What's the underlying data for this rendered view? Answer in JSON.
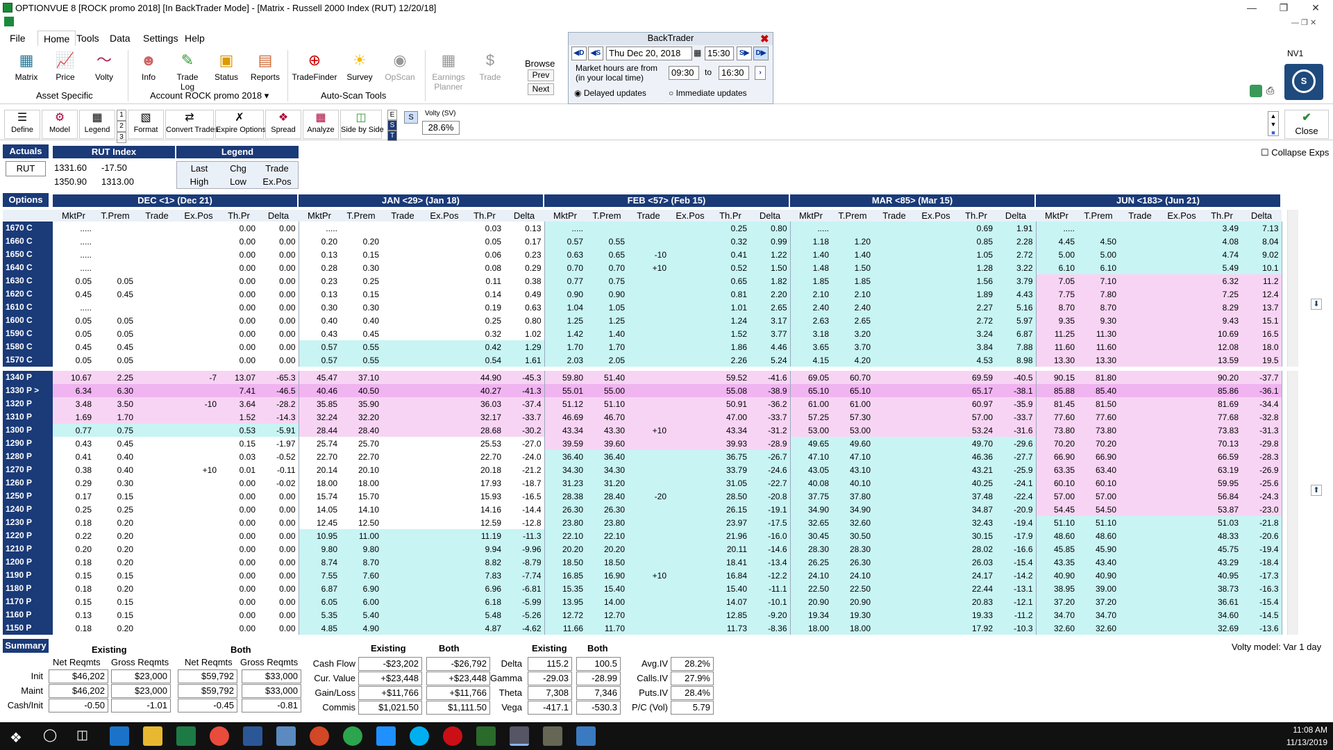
{
  "window": {
    "title": "OPTIONVUE 8   [ROCK promo 2018]   [In BackTrader Mode] - [Matrix - Russell 2000 Index (RUT)  12/20/18]"
  },
  "menu": [
    "File",
    "Home",
    "Tools",
    "Data",
    "Settings",
    "Help"
  ],
  "ribbon": {
    "asset_specific": {
      "label": "Asset Specific",
      "buttons": [
        "Matrix",
        "Price",
        "Volty"
      ]
    },
    "account": {
      "label": "Account ROCK promo 2018 ▾",
      "buttons": [
        "Info",
        "Trade Log",
        "Status",
        "Reports"
      ]
    },
    "autoscan": {
      "label": "Auto-Scan Tools",
      "buttons": [
        "TradeFinder",
        "Survey",
        "OpScan"
      ]
    },
    "extra": [
      "Earnings Planner",
      "Trade"
    ],
    "browse": {
      "label": "Browse",
      "prev": "Prev",
      "next": "Next"
    }
  },
  "backtrader": {
    "title": "BackTrader",
    "date": "Thu Dec 20, 2018",
    "time": "15:30",
    "market_hours_label": "Market hours are from (in your local time)",
    "from": "09:30",
    "to_label": "to",
    "to": "16:30",
    "delayed": "Delayed updates",
    "immediate": "Immediate updates",
    "btn_d": "D",
    "btn_s": "S",
    "btn_s2": "S",
    "btn_d2": "D"
  },
  "nv": "NV1",
  "toolbar2": {
    "buttons": [
      "Define",
      "Model",
      "Legend",
      "Format",
      "Convert Trades",
      "Expire Options",
      "Spread",
      "Analyze",
      "Side by Side"
    ],
    "nums": [
      "1",
      "2",
      "3"
    ],
    "est": [
      "E",
      "S",
      "T"
    ],
    "s_btn": "S",
    "volty_label": "Volty (SV)",
    "volty_value": "28.6%",
    "close": "Close"
  },
  "actuals": {
    "label": "Actuals",
    "symbol": "RUT",
    "index_title": "RUT Index",
    "last": "1331.60",
    "chg": "-17.50",
    "high": "1350.90",
    "low": "1313.00",
    "legend_title": "Legend",
    "legend": [
      "Last",
      "Chg",
      "Trade",
      "High",
      "Low",
      "Ex.Pos"
    ]
  },
  "collapse_label": "Collapse Exps",
  "options_label": "Options",
  "expirations": [
    "DEC <1> (Dec 21)",
    "JAN <29> (Jan 18)",
    "FEB <57> (Feb 15)",
    "MAR <85> (Mar 15)",
    "JUN <183> (Jun 21)"
  ],
  "columns": [
    "MktPr",
    "T.Prem",
    "Trade",
    "Ex.Pos",
    "Th.Pr",
    "Delta"
  ],
  "calls": [
    {
      "s": "1670 C",
      "r": [
        ".....",
        "",
        "",
        "",
        "0.00",
        "0.00",
        ".....",
        "",
        "",
        "",
        "0.03",
        "0.13",
        ".....",
        "",
        "",
        "",
        "0.25",
        "0.80",
        ".....",
        "",
        "",
        "",
        "0.69",
        "1.91",
        ".....",
        "",
        "",
        "",
        "3.49",
        "7.13"
      ]
    },
    {
      "s": "1660 C",
      "r": [
        ".....",
        "",
        "",
        "",
        "0.00",
        "0.00",
        "0.20",
        "0.20",
        "",
        "",
        "0.05",
        "0.17",
        "0.57",
        "0.55",
        "",
        "",
        "0.32",
        "0.99",
        "1.18",
        "1.20",
        "",
        "",
        "0.85",
        "2.28",
        "4.45",
        "4.50",
        "",
        "",
        "4.08",
        "8.04"
      ]
    },
    {
      "s": "1650 C",
      "r": [
        ".....",
        "",
        "",
        "",
        "0.00",
        "0.00",
        "0.13",
        "0.15",
        "",
        "",
        "0.06",
        "0.23",
        "0.63",
        "0.65",
        "-10",
        "",
        "0.41",
        "1.22",
        "1.40",
        "1.40",
        "",
        "",
        "1.05",
        "2.72",
        "5.00",
        "5.00",
        "",
        "",
        "4.74",
        "9.02"
      ]
    },
    {
      "s": "1640 C",
      "r": [
        ".....",
        "",
        "",
        "",
        "0.00",
        "0.00",
        "0.28",
        "0.30",
        "",
        "",
        "0.08",
        "0.29",
        "0.70",
        "0.70",
        "+10",
        "",
        "0.52",
        "1.50",
        "1.48",
        "1.50",
        "",
        "",
        "1.28",
        "3.22",
        "6.10",
        "6.10",
        "",
        "",
        "5.49",
        "10.1"
      ]
    },
    {
      "s": "1630 C",
      "r": [
        "0.05",
        "0.05",
        "",
        "",
        "0.00",
        "0.00",
        "0.23",
        "0.25",
        "",
        "",
        "0.11",
        "0.38",
        "0.77",
        "0.75",
        "",
        "",
        "0.65",
        "1.82",
        "1.85",
        "1.85",
        "",
        "",
        "1.56",
        "3.79",
        "7.05",
        "7.10",
        "",
        "",
        "6.32",
        "11.2"
      ]
    },
    {
      "s": "1620 C",
      "r": [
        "0.45",
        "0.45",
        "",
        "",
        "0.00",
        "0.00",
        "0.13",
        "0.15",
        "",
        "",
        "0.14",
        "0.49",
        "0.90",
        "0.90",
        "",
        "",
        "0.81",
        "2.20",
        "2.10",
        "2.10",
        "",
        "",
        "1.89",
        "4.43",
        "7.75",
        "7.80",
        "",
        "",
        "7.25",
        "12.4"
      ]
    },
    {
      "s": "1610 C",
      "r": [
        ".....",
        "",
        "",
        "",
        "0.00",
        "0.00",
        "0.30",
        "0.30",
        "",
        "",
        "0.19",
        "0.63",
        "1.04",
        "1.05",
        "",
        "",
        "1.01",
        "2.65",
        "2.40",
        "2.40",
        "",
        "",
        "2.27",
        "5.16",
        "8.70",
        "8.70",
        "",
        "",
        "8.29",
        "13.7"
      ]
    },
    {
      "s": "1600 C",
      "r": [
        "0.05",
        "0.05",
        "",
        "",
        "0.00",
        "0.00",
        "0.40",
        "0.40",
        "",
        "",
        "0.25",
        "0.80",
        "1.25",
        "1.25",
        "",
        "",
        "1.24",
        "3.17",
        "2.63",
        "2.65",
        "",
        "",
        "2.72",
        "5.97",
        "9.35",
        "9.30",
        "",
        "",
        "9.43",
        "15.1"
      ]
    },
    {
      "s": "1590 C",
      "r": [
        "0.05",
        "0.05",
        "",
        "",
        "0.00",
        "0.00",
        "0.43",
        "0.45",
        "",
        "",
        "0.32",
        "1.02",
        "1.42",
        "1.40",
        "",
        "",
        "1.52",
        "3.77",
        "3.18",
        "3.20",
        "",
        "",
        "3.24",
        "6.87",
        "11.25",
        "11.30",
        "",
        "",
        "10.69",
        "16.5"
      ]
    },
    {
      "s": "1580 C",
      "r": [
        "0.45",
        "0.45",
        "",
        "",
        "0.00",
        "0.00",
        "0.57",
        "0.55",
        "",
        "",
        "0.42",
        "1.29",
        "1.70",
        "1.70",
        "",
        "",
        "1.86",
        "4.46",
        "3.65",
        "3.70",
        "",
        "",
        "3.84",
        "7.88",
        "11.60",
        "11.60",
        "",
        "",
        "12.08",
        "18.0"
      ]
    },
    {
      "s": "1570 C",
      "r": [
        "0.05",
        "0.05",
        "",
        "",
        "0.00",
        "0.00",
        "0.57",
        "0.55",
        "",
        "",
        "0.54",
        "1.61",
        "2.03",
        "2.05",
        "",
        "",
        "2.26",
        "5.24",
        "4.15",
        "4.20",
        "",
        "",
        "4.53",
        "8.98",
        "13.30",
        "13.30",
        "",
        "",
        "13.59",
        "19.5"
      ]
    }
  ],
  "puts": [
    {
      "s": "1340 P",
      "r": [
        "10.67",
        "2.25",
        "",
        "-7",
        "13.07",
        "-65.3",
        "45.47",
        "37.10",
        "",
        "",
        "44.90",
        "-45.3",
        "59.80",
        "51.40",
        "",
        "",
        "59.52",
        "-41.6",
        "69.05",
        "60.70",
        "",
        "",
        "69.59",
        "-40.5",
        "90.15",
        "81.80",
        "",
        "",
        "90.20",
        "-37.7"
      ]
    },
    {
      "s": "1330 P >",
      "r": [
        "6.34",
        "6.30",
        "",
        "",
        "7.41",
        "-46.5",
        "40.46",
        "40.50",
        "",
        "",
        "40.27",
        "-41.3",
        "55.01",
        "55.00",
        "",
        "",
        "55.08",
        "-38.9",
        "65.10",
        "65.10",
        "",
        "",
        "65.17",
        "-38.1",
        "85.88",
        "85.40",
        "",
        "",
        "85.86",
        "-36.1"
      ]
    },
    {
      "s": "1320 P",
      "r": [
        "3.48",
        "3.50",
        "",
        "-10",
        "3.64",
        "-28.2",
        "35.85",
        "35.90",
        "",
        "",
        "36.03",
        "-37.4",
        "51.12",
        "51.10",
        "",
        "",
        "50.91",
        "-36.2",
        "61.00",
        "61.00",
        "",
        "",
        "60.97",
        "-35.9",
        "81.45",
        "81.50",
        "",
        "",
        "81.69",
        "-34.4"
      ]
    },
    {
      "s": "1310 P",
      "r": [
        "1.69",
        "1.70",
        "",
        "",
        "1.52",
        "-14.3",
        "32.24",
        "32.20",
        "",
        "",
        "32.17",
        "-33.7",
        "46.69",
        "46.70",
        "",
        "",
        "47.00",
        "-33.7",
        "57.25",
        "57.30",
        "",
        "",
        "57.00",
        "-33.7",
        "77.60",
        "77.60",
        "",
        "",
        "77.68",
        "-32.8"
      ]
    },
    {
      "s": "1300 P",
      "r": [
        "0.77",
        "0.75",
        "",
        "",
        "0.53",
        "-5.91",
        "28.44",
        "28.40",
        "",
        "",
        "28.68",
        "-30.2",
        "43.34",
        "43.30",
        "+10",
        "",
        "43.34",
        "-31.2",
        "53.00",
        "53.00",
        "",
        "",
        "53.24",
        "-31.6",
        "73.80",
        "73.80",
        "",
        "",
        "73.83",
        "-31.3"
      ]
    },
    {
      "s": "1290 P",
      "r": [
        "0.43",
        "0.45",
        "",
        "",
        "0.15",
        "-1.97",
        "25.74",
        "25.70",
        "",
        "",
        "25.53",
        "-27.0",
        "39.59",
        "39.60",
        "",
        "",
        "39.93",
        "-28.9",
        "49.65",
        "49.60",
        "",
        "",
        "49.70",
        "-29.6",
        "70.20",
        "70.20",
        "",
        "",
        "70.13",
        "-29.8"
      ]
    },
    {
      "s": "1280 P",
      "r": [
        "0.41",
        "0.40",
        "",
        "",
        "0.03",
        "-0.52",
        "22.70",
        "22.70",
        "",
        "",
        "22.70",
        "-24.0",
        "36.40",
        "36.40",
        "",
        "",
        "36.75",
        "-26.7",
        "47.10",
        "47.10",
        "",
        "",
        "46.36",
        "-27.7",
        "66.90",
        "66.90",
        "",
        "",
        "66.59",
        "-28.3"
      ]
    },
    {
      "s": "1270 P",
      "r": [
        "0.38",
        "0.40",
        "",
        "+10",
        "0.01",
        "-0.11",
        "20.14",
        "20.10",
        "",
        "",
        "20.18",
        "-21.2",
        "34.30",
        "34.30",
        "",
        "",
        "33.79",
        "-24.6",
        "43.05",
        "43.10",
        "",
        "",
        "43.21",
        "-25.9",
        "63.35",
        "63.40",
        "",
        "",
        "63.19",
        "-26.9"
      ]
    },
    {
      "s": "1260 P",
      "r": [
        "0.29",
        "0.30",
        "",
        "",
        "0.00",
        "-0.02",
        "18.00",
        "18.00",
        "",
        "",
        "17.93",
        "-18.7",
        "31.23",
        "31.20",
        "",
        "",
        "31.05",
        "-22.7",
        "40.08",
        "40.10",
        "",
        "",
        "40.25",
        "-24.1",
        "60.10",
        "60.10",
        "",
        "",
        "59.95",
        "-25.6"
      ]
    },
    {
      "s": "1250 P",
      "r": [
        "0.17",
        "0.15",
        "",
        "",
        "0.00",
        "0.00",
        "15.74",
        "15.70",
        "",
        "",
        "15.93",
        "-16.5",
        "28.38",
        "28.40",
        "-20",
        "",
        "28.50",
        "-20.8",
        "37.75",
        "37.80",
        "",
        "",
        "37.48",
        "-22.4",
        "57.00",
        "57.00",
        "",
        "",
        "56.84",
        "-24.3"
      ]
    },
    {
      "s": "1240 P",
      "r": [
        "0.25",
        "0.25",
        "",
        "",
        "0.00",
        "0.00",
        "14.05",
        "14.10",
        "",
        "",
        "14.16",
        "-14.4",
        "26.30",
        "26.30",
        "",
        "",
        "26.15",
        "-19.1",
        "34.90",
        "34.90",
        "",
        "",
        "34.87",
        "-20.9",
        "54.45",
        "54.50",
        "",
        "",
        "53.87",
        "-23.0"
      ]
    },
    {
      "s": "1230 P",
      "r": [
        "0.18",
        "0.20",
        "",
        "",
        "0.00",
        "0.00",
        "12.45",
        "12.50",
        "",
        "",
        "12.59",
        "-12.8",
        "23.80",
        "23.80",
        "",
        "",
        "23.97",
        "-17.5",
        "32.65",
        "32.60",
        "",
        "",
        "32.43",
        "-19.4",
        "51.10",
        "51.10",
        "",
        "",
        "51.03",
        "-21.8"
      ]
    },
    {
      "s": "1220 P",
      "r": [
        "0.22",
        "0.20",
        "",
        "",
        "0.00",
        "0.00",
        "10.95",
        "11.00",
        "",
        "",
        "11.19",
        "-11.3",
        "22.10",
        "22.10",
        "",
        "",
        "21.96",
        "-16.0",
        "30.45",
        "30.50",
        "",
        "",
        "30.15",
        "-17.9",
        "48.60",
        "48.60",
        "",
        "",
        "48.33",
        "-20.6"
      ]
    },
    {
      "s": "1210 P",
      "r": [
        "0.20",
        "0.20",
        "",
        "",
        "0.00",
        "0.00",
        "9.80",
        "9.80",
        "",
        "",
        "9.94",
        "-9.96",
        "20.20",
        "20.20",
        "",
        "",
        "20.11",
        "-14.6",
        "28.30",
        "28.30",
        "",
        "",
        "28.02",
        "-16.6",
        "45.85",
        "45.90",
        "",
        "",
        "45.75",
        "-19.4"
      ]
    },
    {
      "s": "1200 P",
      "r": [
        "0.18",
        "0.20",
        "",
        "",
        "0.00",
        "0.00",
        "8.74",
        "8.70",
        "",
        "",
        "8.82",
        "-8.79",
        "18.50",
        "18.50",
        "",
        "",
        "18.41",
        "-13.4",
        "26.25",
        "26.30",
        "",
        "",
        "26.03",
        "-15.4",
        "43.35",
        "43.40",
        "",
        "",
        "43.29",
        "-18.4"
      ]
    },
    {
      "s": "1190 P",
      "r": [
        "0.15",
        "0.15",
        "",
        "",
        "0.00",
        "0.00",
        "7.55",
        "7.60",
        "",
        "",
        "7.83",
        "-7.74",
        "16.85",
        "16.90",
        "+10",
        "",
        "16.84",
        "-12.2",
        "24.10",
        "24.10",
        "",
        "",
        "24.17",
        "-14.2",
        "40.90",
        "40.90",
        "",
        "",
        "40.95",
        "-17.3"
      ]
    },
    {
      "s": "1180 P",
      "r": [
        "0.18",
        "0.20",
        "",
        "",
        "0.00",
        "0.00",
        "6.87",
        "6.90",
        "",
        "",
        "6.96",
        "-6.81",
        "15.35",
        "15.40",
        "",
        "",
        "15.40",
        "-11.1",
        "22.50",
        "22.50",
        "",
        "",
        "22.44",
        "-13.1",
        "38.95",
        "39.00",
        "",
        "",
        "38.73",
        "-16.3"
      ]
    },
    {
      "s": "1170 P",
      "r": [
        "0.15",
        "0.15",
        "",
        "",
        "0.00",
        "0.00",
        "6.05",
        "6.00",
        "",
        "",
        "6.18",
        "-5.99",
        "13.95",
        "14.00",
        "",
        "",
        "14.07",
        "-10.1",
        "20.90",
        "20.90",
        "",
        "",
        "20.83",
        "-12.1",
        "37.20",
        "37.20",
        "",
        "",
        "36.61",
        "-15.4"
      ]
    },
    {
      "s": "1160 P",
      "r": [
        "0.13",
        "0.15",
        "",
        "",
        "0.00",
        "0.00",
        "5.35",
        "5.40",
        "",
        "",
        "5.48",
        "-5.26",
        "12.72",
        "12.70",
        "",
        "",
        "12.85",
        "-9.20",
        "19.34",
        "19.30",
        "",
        "",
        "19.33",
        "-11.2",
        "34.70",
        "34.70",
        "",
        "",
        "34.60",
        "-14.5"
      ]
    },
    {
      "s": "1150 P",
      "r": [
        "0.18",
        "0.20",
        "",
        "",
        "0.00",
        "0.00",
        "4.85",
        "4.90",
        "",
        "",
        "4.87",
        "-4.62",
        "11.66",
        "11.70",
        "",
        "",
        "11.73",
        "-8.36",
        "18.00",
        "18.00",
        "",
        "",
        "17.92",
        "-10.3",
        "32.60",
        "32.60",
        "",
        "",
        "32.69",
        "-13.6"
      ]
    }
  ],
  "summary": {
    "label": "Summary",
    "volty_model": "Volty model: Var 1 day",
    "existing": "Existing",
    "both": "Both",
    "net": "Net Reqmts",
    "gross": "Gross Reqmts",
    "reqs": [
      {
        "l": "Init",
        "v": [
          "$46,202",
          "$23,000",
          "$59,792",
          "$33,000"
        ]
      },
      {
        "l": "Maint",
        "v": [
          "$46,202",
          "$23,000",
          "$59,792",
          "$33,000"
        ]
      },
      {
        "l": "Cash/Init",
        "v": [
          "-0.50",
          "-1.01",
          "-0.45",
          "-0.81"
        ]
      }
    ],
    "cash": [
      {
        "l": "Cash Flow",
        "v": [
          "-$23,202",
          "-$26,792"
        ]
      },
      {
        "l": "Cur. Value",
        "v": [
          "+$23,448",
          "+$23,448"
        ]
      },
      {
        "l": "Gain/Loss",
        "v": [
          "+$11,766",
          "+$11,766"
        ]
      },
      {
        "l": "Commis",
        "v": [
          "$1,021.50",
          "$1,111.50"
        ]
      }
    ],
    "greeks": [
      {
        "l": "Delta",
        "v": [
          "115.2",
          "100.5"
        ]
      },
      {
        "l": "Gamma",
        "v": [
          "-29.03",
          "-28.99"
        ]
      },
      {
        "l": "Theta",
        "v": [
          "7,308",
          "7,346"
        ]
      },
      {
        "l": "Vega",
        "v": [
          "-417.1",
          "-530.3"
        ]
      }
    ],
    "iv": [
      {
        "l": "Avg.IV",
        "v": "28.2%"
      },
      {
        "l": "Calls.IV",
        "v": "27.9%"
      },
      {
        "l": "Puts.IV",
        "v": "28.4%"
      },
      {
        "l": "P/C (Vol)",
        "v": "5.79"
      }
    ]
  },
  "clock": {
    "time": "11:08 AM",
    "date": "11/13/2019"
  }
}
